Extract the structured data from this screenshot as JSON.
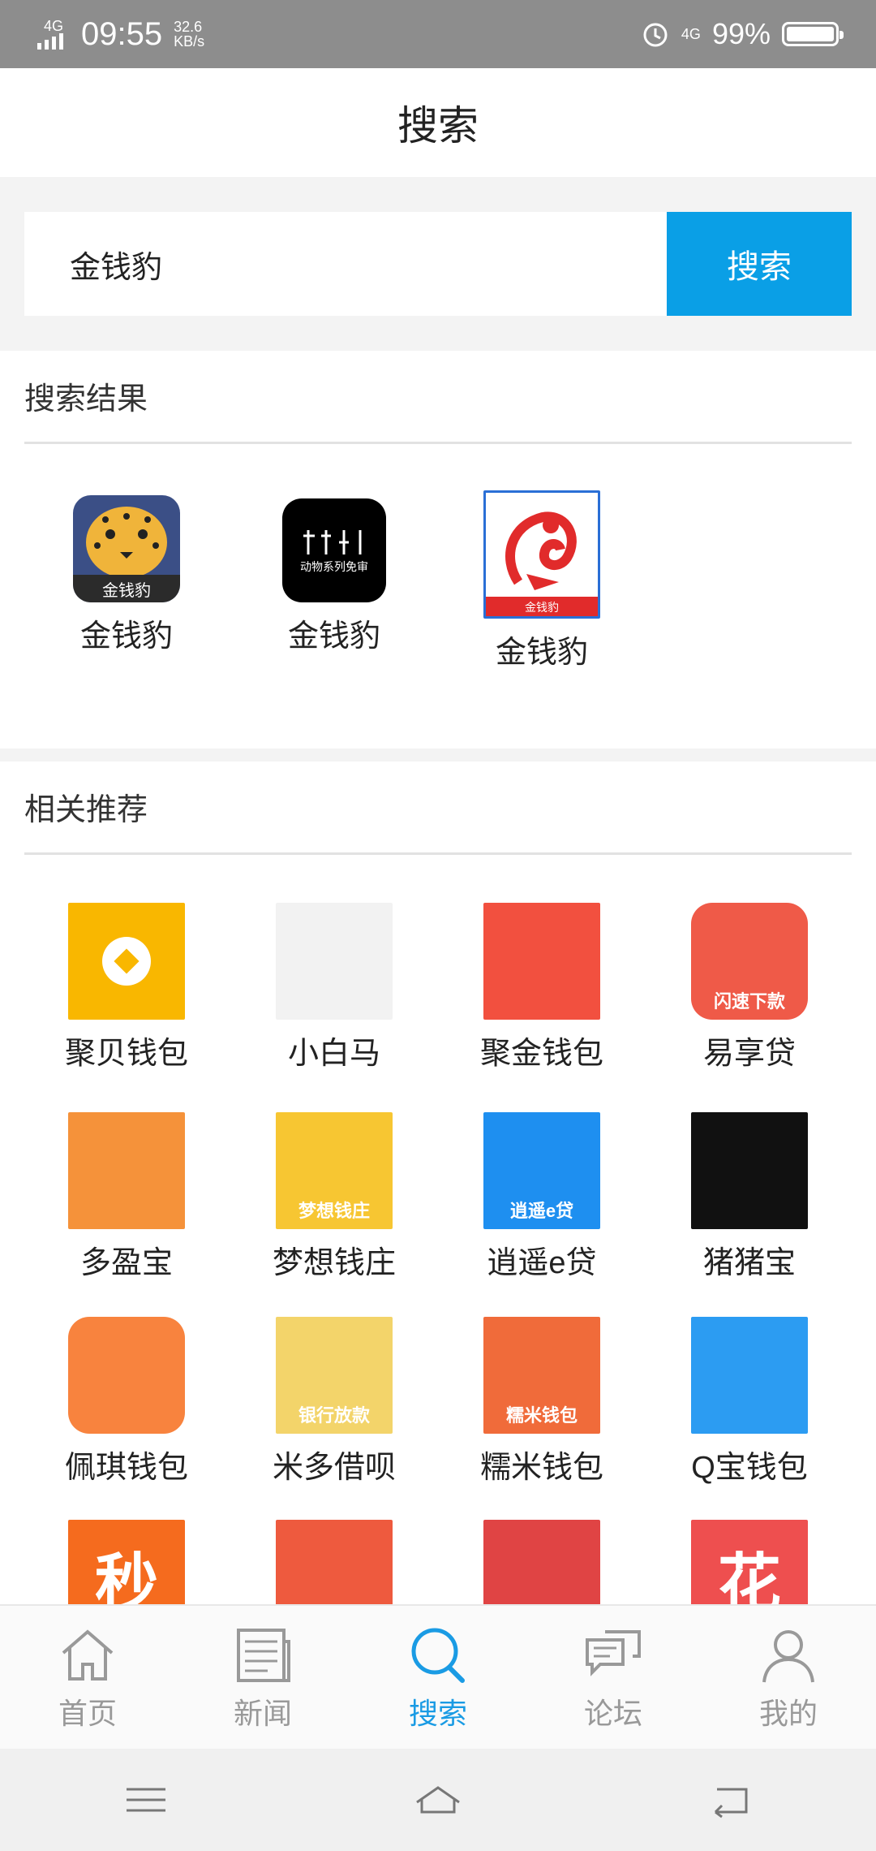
{
  "status_bar": {
    "network": "4G",
    "time": "09:55",
    "speed": "32.6",
    "speed_unit": "KB/s",
    "network2": "4G",
    "battery": "99%"
  },
  "header": {
    "title": "搜索"
  },
  "search": {
    "query": "金钱豹",
    "button_label": "搜索"
  },
  "results": {
    "title": "搜索结果",
    "items": [
      {
        "label": "金钱豹",
        "icon": "leopard-app-icon"
      },
      {
        "label": "金钱豹",
        "icon": "black-app-icon",
        "icon_text": "动物系列免审"
      },
      {
        "label": "金钱豹",
        "icon": "red-rooster-app-icon"
      }
    ]
  },
  "recommend": {
    "title": "相关推荐",
    "items": [
      {
        "label": "聚贝钱包",
        "color": "#f9b700"
      },
      {
        "label": "小白马",
        "color": "#f2f2f2"
      },
      {
        "label": "聚金钱包",
        "color": "#f2503f"
      },
      {
        "label": "易享贷",
        "color": "#ef5a48",
        "icon_text": "闪速下款"
      },
      {
        "label": "多盈宝",
        "color": "#f5923a"
      },
      {
        "label": "梦想钱庄",
        "color": "#f7c632",
        "icon_text": "梦想钱庄"
      },
      {
        "label": "逍遥e贷",
        "color": "#1e8ff0",
        "icon_text": "逍遥e贷"
      },
      {
        "label": "猪猪宝",
        "color": "#111111"
      },
      {
        "label": "佩琪钱包",
        "color": "#f8833e"
      },
      {
        "label": "米多借呗",
        "color": "#f3d46a",
        "icon_text": "银行放款"
      },
      {
        "label": "糯米钱包",
        "color": "#f06b3a",
        "icon_text": "糯米钱包"
      },
      {
        "label": "Q宝钱包",
        "color": "#2c9cf2"
      },
      {
        "label": "",
        "color": "#f56b1e",
        "icon_text": "秒"
      },
      {
        "label": "",
        "color": "#ee5a3e"
      },
      {
        "label": "",
        "color": "#e04444"
      },
      {
        "label": "",
        "color": "#ee4f4f",
        "icon_text": "花"
      }
    ]
  },
  "tabs": [
    {
      "label": "首页",
      "icon": "home-icon"
    },
    {
      "label": "新闻",
      "icon": "news-icon"
    },
    {
      "label": "搜索",
      "icon": "search-icon",
      "active": true
    },
    {
      "label": "论坛",
      "icon": "forum-icon"
    },
    {
      "label": "我的",
      "icon": "profile-icon"
    }
  ]
}
